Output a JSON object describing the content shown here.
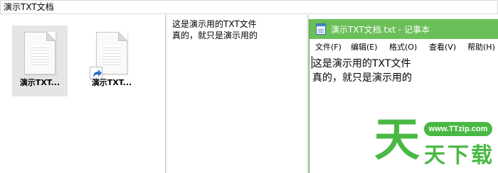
{
  "address_bar": {
    "text": "演示TXT文档"
  },
  "files": [
    {
      "label": "演示TXT...",
      "icon": "text-document-icon",
      "selected": true,
      "shortcut": false
    },
    {
      "label": "演示TXT...",
      "icon": "text-document-shortcut-icon",
      "selected": false,
      "shortcut": true
    }
  ],
  "preview": {
    "lines": [
      "这是演示用的TXT文件",
      "真的，就只是演示用的"
    ]
  },
  "notepad": {
    "title": "演示TXT文档.txt - 记事本",
    "menu": [
      "文件(F)",
      "编辑(E)",
      "格式(O)",
      "查看(V)",
      "帮助(H)"
    ],
    "lines": [
      "这是演示用的TXT文件",
      "真的，就只是演示用的"
    ],
    "titlebar_color": "#6bbf59"
  },
  "watermark": {
    "url": "www.TTzip.com",
    "logo_char": "天",
    "brand": "天下载",
    "color": "#49b944"
  }
}
